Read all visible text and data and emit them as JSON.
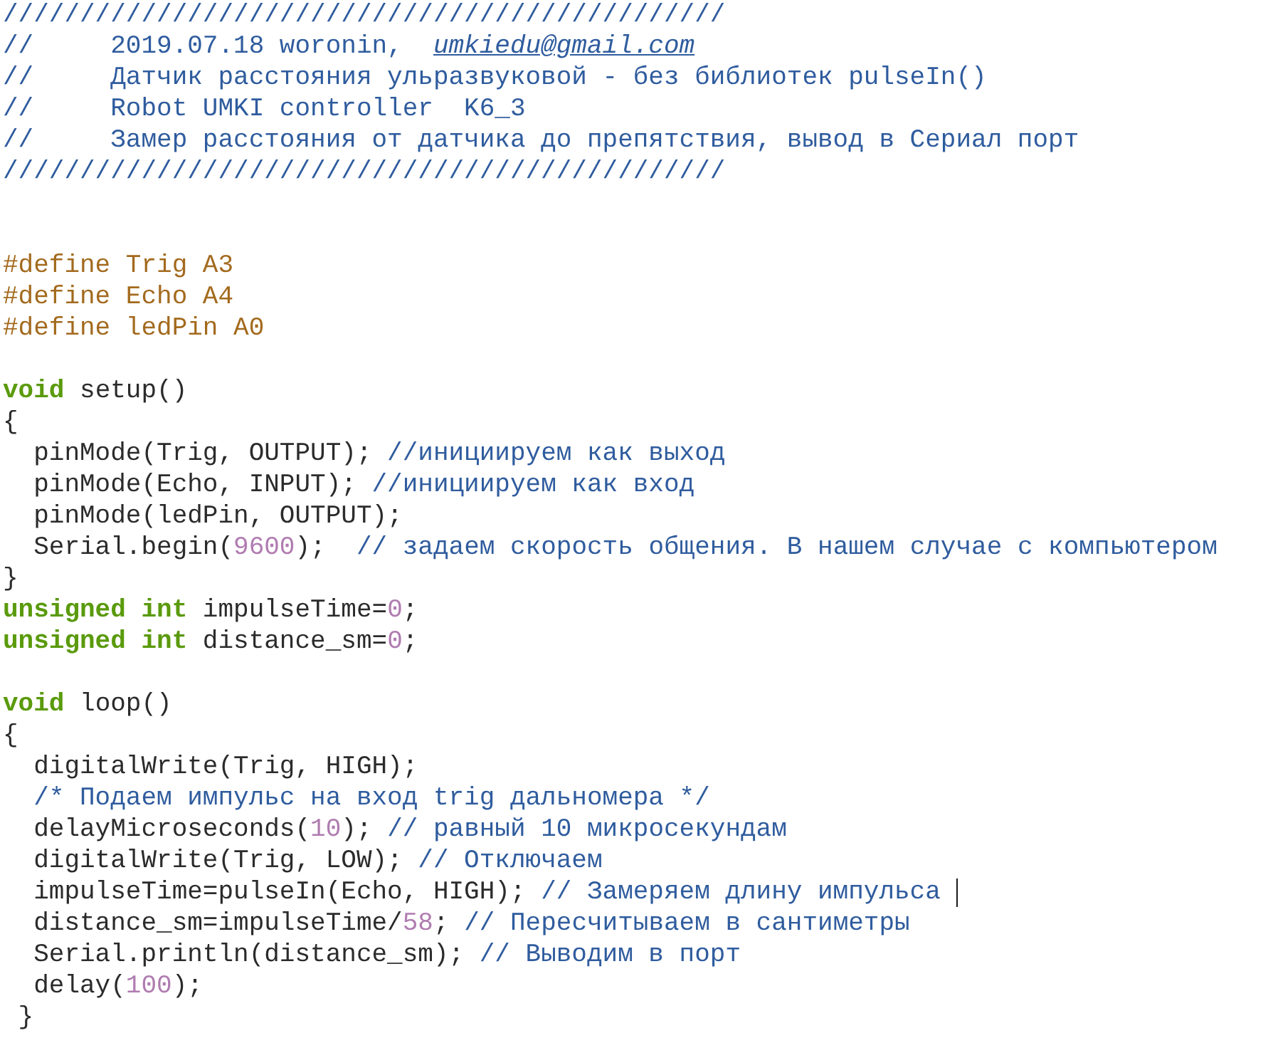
{
  "editor": {
    "lines": [
      {
        "kind": "code",
        "tokens": [
          {
            "kind": "comment",
            "text": "///////////////////////////////////////////////"
          }
        ]
      },
      {
        "kind": "code",
        "tokens": [
          {
            "kind": "comment",
            "text": "//     2019.07.18 woronin,  "
          },
          {
            "kind": "link",
            "text": "umkiedu@gmail.com"
          }
        ]
      },
      {
        "kind": "code",
        "tokens": [
          {
            "kind": "comment",
            "text": "//     Датчик расстояния ульразвуковой - без библиотек pulseIn()"
          }
        ]
      },
      {
        "kind": "code",
        "tokens": [
          {
            "kind": "comment",
            "text": "//     Robot UMKI controller  K6_3"
          }
        ]
      },
      {
        "kind": "code",
        "tokens": [
          {
            "kind": "comment",
            "text": "//     Замер расстояния от датчика до препятствия, вывод в Сериал порт"
          }
        ]
      },
      {
        "kind": "code",
        "tokens": [
          {
            "kind": "comment",
            "text": "///////////////////////////////////////////////"
          }
        ]
      },
      {
        "kind": "blank"
      },
      {
        "kind": "blank"
      },
      {
        "kind": "code",
        "tokens": [
          {
            "kind": "preprocessor",
            "text": "#define Trig A3"
          }
        ]
      },
      {
        "kind": "code",
        "tokens": [
          {
            "kind": "preprocessor",
            "text": "#define Echo A4"
          }
        ]
      },
      {
        "kind": "code",
        "tokens": [
          {
            "kind": "preprocessor",
            "text": "#define ledPin A0"
          }
        ]
      },
      {
        "kind": "blank"
      },
      {
        "kind": "code",
        "tokens": [
          {
            "kind": "keyword",
            "text": "void"
          },
          {
            "kind": "text",
            "text": " setup()"
          }
        ]
      },
      {
        "kind": "code",
        "tokens": [
          {
            "kind": "text",
            "text": "{"
          }
        ]
      },
      {
        "kind": "code",
        "tokens": [
          {
            "kind": "text",
            "text": "  pinMode(Trig, OUTPUT); "
          },
          {
            "kind": "comment",
            "text": "//инициируем как выход"
          }
        ]
      },
      {
        "kind": "code",
        "tokens": [
          {
            "kind": "text",
            "text": "  pinMode(Echo, INPUT); "
          },
          {
            "kind": "comment",
            "text": "//инициируем как вход"
          }
        ]
      },
      {
        "kind": "code",
        "tokens": [
          {
            "kind": "text",
            "text": "  pinMode(ledPin, OUTPUT);"
          }
        ]
      },
      {
        "kind": "code",
        "tokens": [
          {
            "kind": "text",
            "text": "  Serial.begin("
          },
          {
            "kind": "number",
            "text": "9600"
          },
          {
            "kind": "text",
            "text": ");  "
          },
          {
            "kind": "comment",
            "text": "// задаем скорость общения. В нашем случае с компьютером"
          }
        ]
      },
      {
        "kind": "code",
        "tokens": [
          {
            "kind": "text",
            "text": "}"
          }
        ]
      },
      {
        "kind": "code",
        "tokens": [
          {
            "kind": "keyword",
            "text": "unsigned int"
          },
          {
            "kind": "text",
            "text": " impulseTime="
          },
          {
            "kind": "number",
            "text": "0"
          },
          {
            "kind": "text",
            "text": ";"
          }
        ]
      },
      {
        "kind": "code",
        "tokens": [
          {
            "kind": "keyword",
            "text": "unsigned int"
          },
          {
            "kind": "text",
            "text": " distance_sm="
          },
          {
            "kind": "number",
            "text": "0"
          },
          {
            "kind": "text",
            "text": ";"
          }
        ]
      },
      {
        "kind": "blank"
      },
      {
        "kind": "code",
        "tokens": [
          {
            "kind": "keyword",
            "text": "void"
          },
          {
            "kind": "text",
            "text": " loop()"
          }
        ]
      },
      {
        "kind": "code",
        "tokens": [
          {
            "kind": "text",
            "text": "{"
          }
        ]
      },
      {
        "kind": "code",
        "tokens": [
          {
            "kind": "text",
            "text": "  digitalWrite(Trig, HIGH);"
          }
        ]
      },
      {
        "kind": "code",
        "tokens": [
          {
            "kind": "comment",
            "text": "  /* Подаем импульс на вход trig дальномера */"
          }
        ]
      },
      {
        "kind": "code",
        "tokens": [
          {
            "kind": "text",
            "text": "  delayMicroseconds("
          },
          {
            "kind": "number",
            "text": "10"
          },
          {
            "kind": "text",
            "text": "); "
          },
          {
            "kind": "comment",
            "text": "// равный 10 микросекундам"
          }
        ]
      },
      {
        "kind": "code",
        "tokens": [
          {
            "kind": "text",
            "text": "  digitalWrite(Trig, LOW); "
          },
          {
            "kind": "comment",
            "text": "// Отключаем"
          }
        ]
      },
      {
        "kind": "code",
        "caret": true,
        "tokens": [
          {
            "kind": "text",
            "text": "  impulseTime=pulseIn(Echo, HIGH); "
          },
          {
            "kind": "comment",
            "text": "// Замеряем длину импульса"
          }
        ]
      },
      {
        "kind": "code",
        "tokens": [
          {
            "kind": "text",
            "text": "  distance_sm=impulseTime/"
          },
          {
            "kind": "number",
            "text": "58"
          },
          {
            "kind": "text",
            "text": "; "
          },
          {
            "kind": "comment",
            "text": "// Пересчитываем в сантиметры"
          }
        ]
      },
      {
        "kind": "code",
        "tokens": [
          {
            "kind": "text",
            "text": "  Serial.println(distance_sm); "
          },
          {
            "kind": "comment",
            "text": "// Выводим в порт"
          }
        ]
      },
      {
        "kind": "code",
        "tokens": [
          {
            "kind": "text",
            "text": "  delay("
          },
          {
            "kind": "number",
            "text": "100"
          },
          {
            "kind": "text",
            "text": ");"
          }
        ]
      },
      {
        "kind": "code",
        "tokens": [
          {
            "kind": "text",
            "text": " }"
          }
        ]
      }
    ]
  }
}
